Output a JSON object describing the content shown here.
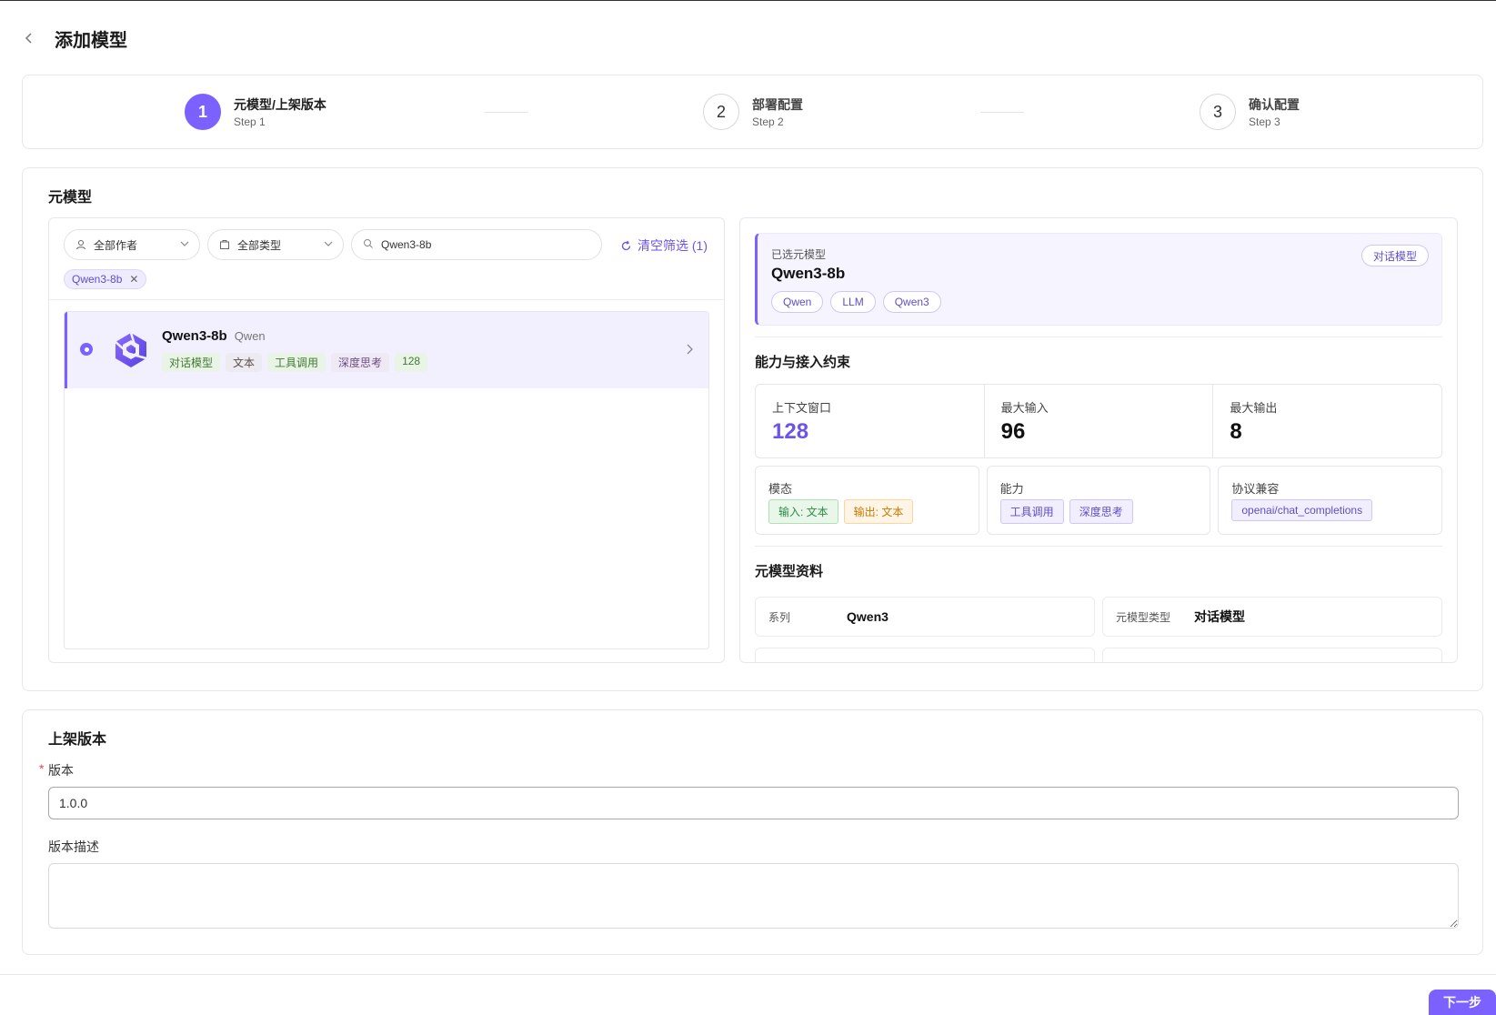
{
  "header": {
    "title": "添加模型"
  },
  "steps": [
    {
      "number": "1",
      "title": "元模型/上架版本",
      "subtitle": "Step 1"
    },
    {
      "number": "2",
      "title": "部署配置",
      "subtitle": "Step 2"
    },
    {
      "number": "3",
      "title": "确认配置",
      "subtitle": "Step 3"
    }
  ],
  "meta_section": {
    "title": "元模型",
    "filters": {
      "author": "全部作者",
      "type": "全部类型",
      "search_value": "Qwen3-8b",
      "clear_label": "清空筛选 (1)",
      "active_chip": "Qwen3-8b"
    },
    "model_list": [
      {
        "name": "Qwen3-8b",
        "author": "Qwen",
        "tags": [
          "对话模型",
          "文本",
          "工具调用",
          "深度思考",
          "128"
        ]
      }
    ],
    "selected": {
      "label": "已选元模型",
      "name": "Qwen3-8b",
      "type_badge": "对话模型",
      "tags": [
        "Qwen",
        "LLM",
        "Qwen3"
      ]
    },
    "capabilities": {
      "title": "能力与接入约束",
      "metrics": [
        {
          "label": "上下文窗口",
          "value": "128"
        },
        {
          "label": "最大输入",
          "value": "96"
        },
        {
          "label": "最大输出",
          "value": "8"
        }
      ],
      "modality": {
        "label": "模态",
        "tags": [
          "输入: 文本",
          "输出: 文本"
        ]
      },
      "ability": {
        "label": "能力",
        "tags": [
          "工具调用",
          "深度思考"
        ]
      },
      "protocol": {
        "label": "协议兼容",
        "tags": [
          "openai/chat_completions"
        ]
      }
    },
    "info": {
      "title": "元模型资料",
      "rows": [
        {
          "key": "系列",
          "value": "Qwen3"
        },
        {
          "key": "元模型类型",
          "value": "对话模型"
        }
      ]
    }
  },
  "version_section": {
    "title": "上架版本",
    "version_label": "版本",
    "version_value": "1.0.0",
    "desc_label": "版本描述",
    "desc_value": ""
  },
  "footer": {
    "next_label": "下一步"
  },
  "colors": {
    "accent": "#7b61ff",
    "accent_text": "#6a55e6"
  }
}
